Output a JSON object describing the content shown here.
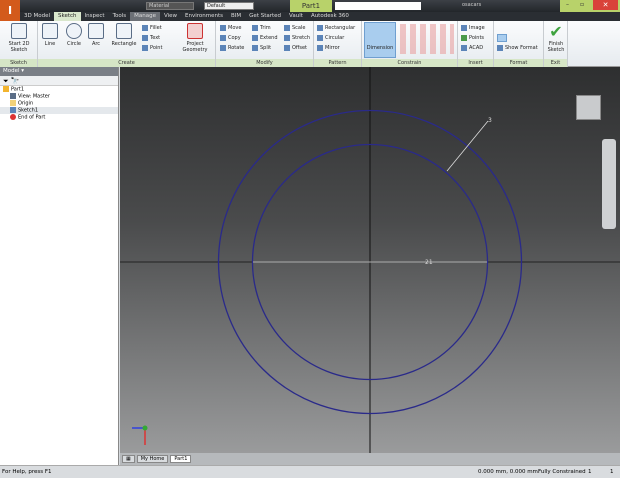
{
  "app": {
    "document_title": "Part1",
    "appearance": "Material",
    "style": "Default",
    "username": "osacars"
  },
  "tabs": [
    "3D Model",
    "Sketch",
    "Inspect",
    "Tools",
    "Manage",
    "View",
    "Environments",
    "BIM",
    "Get Started",
    "Vault",
    "Autodesk 360"
  ],
  "active_tab": "Sketch",
  "ribbon": {
    "sketch": {
      "label": "Sketch",
      "start": "Start 2D Sketch"
    },
    "create": {
      "label": "Create",
      "line": "Line",
      "circle": "Circle",
      "arc": "Arc",
      "rectangle": "Rectangle",
      "fillet": "Fillet",
      "text": "Text",
      "point": "Point",
      "project": "Project Geometry"
    },
    "modify": {
      "label": "Modify",
      "items": [
        "Move",
        "Trim",
        "Scale",
        "Copy",
        "Extend",
        "Stretch",
        "Rotate",
        "Split",
        "Offset"
      ]
    },
    "pattern": {
      "label": "Pattern",
      "items": [
        "Rectangular",
        "Circular",
        "Mirror"
      ]
    },
    "constrain": {
      "label": "Constrain",
      "dimension": "Dimension"
    },
    "insert": {
      "label": "Insert",
      "items": [
        "Image",
        "Points",
        "ACAD"
      ]
    },
    "format": {
      "label": "Format",
      "show_format": "Show Format"
    },
    "exit": {
      "label": "Exit",
      "finish": "Finish Sketch"
    }
  },
  "browser": {
    "title": "Model",
    "nodes": [
      "Part1",
      "View: Master",
      "Origin",
      "Sketch1",
      "End of Part"
    ]
  },
  "sketch": {
    "dimension_offset": "3",
    "dimension_diameter": "21",
    "line_color": "#2a2a8a"
  },
  "doc_tabs": [
    "My Home",
    "Part1"
  ],
  "status": {
    "help": "For Help, press F1",
    "coords": "0.000 mm, 0.000 mm",
    "state": "Fully Constrained",
    "count1": "1",
    "count2": "1"
  }
}
